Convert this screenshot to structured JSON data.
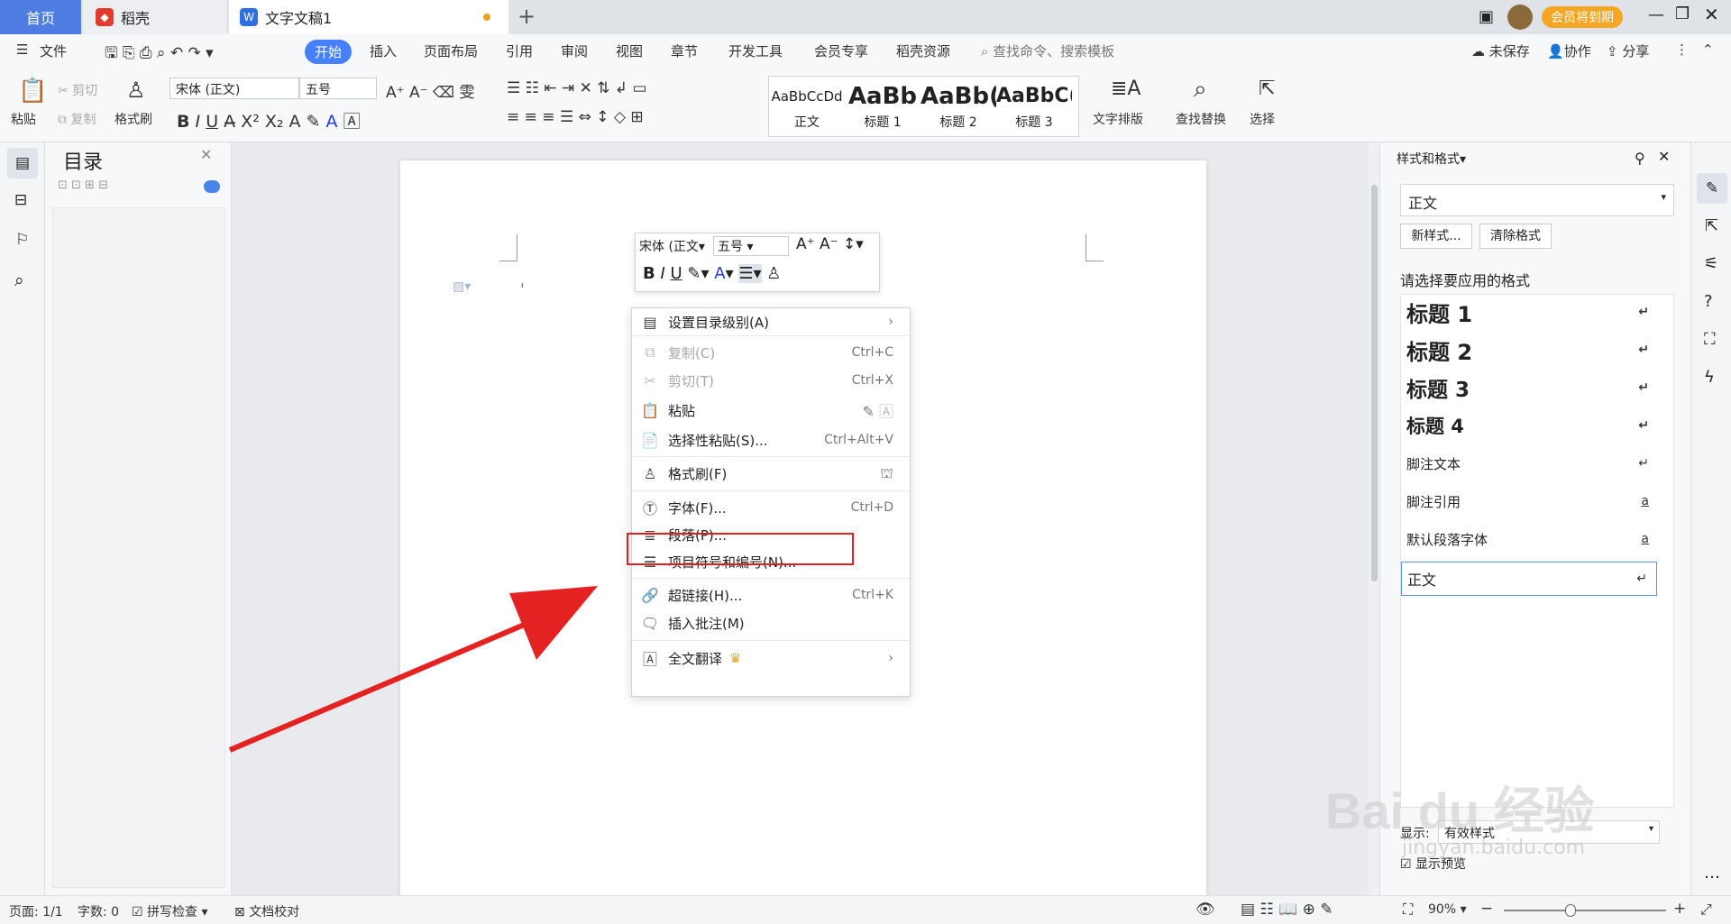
{
  "tabs": {
    "home": "首页",
    "daoke": "稻壳",
    "doc": "文字文稿1",
    "add": "+"
  },
  "titlebar": {
    "vip": "会员将到期"
  },
  "menubar": {
    "file": "文件",
    "items": [
      "开始",
      "插入",
      "页面布局",
      "引用",
      "审阅",
      "视图",
      "章节",
      "开发工具",
      "会员专享",
      "稻壳资源"
    ],
    "search": "查找命令、搜索模板",
    "unsaved": "未保存",
    "collab": "协作",
    "share": "分享"
  },
  "ribbon": {
    "paste": "粘贴",
    "cut": "剪切",
    "copy": "复制",
    "format_brush": "格式刷",
    "font": "宋体 (正文)",
    "size": "五号",
    "styles": [
      {
        "preview": "AaBbCcDd",
        "label": "正文"
      },
      {
        "preview": "AaBb",
        "label": "标题 1"
      },
      {
        "preview": "AaBb(",
        "label": "标题 2"
      },
      {
        "preview": "AaBbC(",
        "label": "标题 3"
      }
    ],
    "text_layout": "文字排版",
    "find_replace": "查找替换",
    "select": "选择"
  },
  "nav": {
    "title": "目录"
  },
  "minitoolbar": {
    "font": "宋体 (正文",
    "size": "五号"
  },
  "context_menu": [
    {
      "label": "设置目录级别(A)",
      "shortcut": "",
      "arrow": "›",
      "disabled": false
    },
    {
      "label": "复制(C)",
      "shortcut": "Ctrl+C",
      "disabled": true
    },
    {
      "label": "剪切(T)",
      "shortcut": "Ctrl+X",
      "disabled": true
    },
    {
      "label": "粘贴",
      "shortcut": "",
      "disabled": false
    },
    {
      "label": "选择性粘贴(S)...",
      "shortcut": "Ctrl+Alt+V",
      "disabled": false
    },
    {
      "label": "格式刷(F)",
      "shortcut": "",
      "disabled": false
    },
    {
      "label": "字体(F)...",
      "shortcut": "Ctrl+D",
      "disabled": false
    },
    {
      "label": "段落(P)...",
      "shortcut": "",
      "disabled": false
    },
    {
      "label": "项目符号和编号(N)...",
      "shortcut": "",
      "disabled": false
    },
    {
      "label": "超链接(H)...",
      "shortcut": "Ctrl+K",
      "disabled": false
    },
    {
      "label": "插入批注(M)",
      "shortcut": "",
      "disabled": false
    },
    {
      "label": "全文翻译",
      "shortcut": "",
      "arrow": "›",
      "disabled": false
    }
  ],
  "styles_panel": {
    "title": "样式和格式",
    "current": "正文",
    "new_style": "新样式...",
    "clear_format": "清除格式",
    "prompt": "请选择要应用的格式",
    "formats": [
      "标题  1",
      "标题  2",
      "标题  3",
      "标题  4",
      "脚注文本",
      "脚注引用",
      "默认段落字体",
      "正文"
    ],
    "show_label": "显示:",
    "show_value": "有效样式",
    "preview_label": "显示预览"
  },
  "status": {
    "page": "页面: 1/1",
    "words": "字数: 0",
    "spell": "拼写检查",
    "proof": "文档校对",
    "zoom": "90%"
  },
  "watermark": {
    "text": "Bai du 经验",
    "url": "jingyan.baidu.com"
  }
}
